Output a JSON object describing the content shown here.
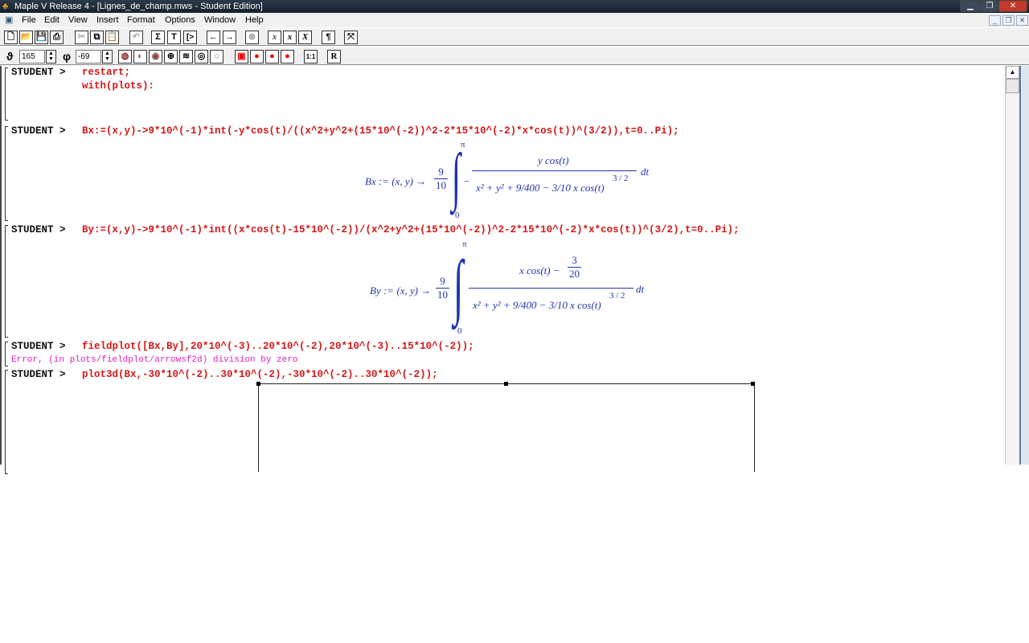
{
  "window": {
    "title": "Maple V Release 4 - [Lignes_de_champ.mws - Student Edition]"
  },
  "menu": [
    "File",
    "Edit",
    "View",
    "Insert",
    "Format",
    "Options",
    "Window",
    "Help"
  ],
  "toolbar1": [
    "new",
    "open",
    "save",
    "print",
    "cut",
    "copy",
    "paste",
    "undo",
    "Σ",
    "T",
    "[>",
    "←",
    "→",
    "stop",
    "x",
    "x",
    "X",
    "¶",
    "⤧"
  ],
  "plot_toolbar": {
    "theta_symbol": "ϑ",
    "theta": "165",
    "phi_symbol": "φ",
    "phi": "-69",
    "ratio": "1:1",
    "r": "R"
  },
  "worksheet": {
    "prompt": "STUDENT >",
    "inputs": [
      [
        "restart;",
        "with(plots):"
      ],
      [
        "Bx:=(x,y)->9*10^(-1)*int(-y*cos(t)/((x^2+y^2+(15*10^(-2))^2-2*15*10^(-2)*x*cos(t))^(3/2)),t=0..Pi);"
      ],
      [
        "By:=(x,y)->9*10^(-1)*int((x*cos(t)-15*10^(-2))/(x^2+y^2+(15*10^(-2))^2-2*15*10^(-2)*x*cos(t))^(3/2),t=0..Pi);"
      ],
      [
        "fieldplot([Bx,By],20*10^(-3)..20*10^(-2),20*10^(-3)..15*10^(-2));"
      ],
      [
        "plot3d(Bx,-30*10^(-2)..30*10^(-2),-30*10^(-2)..30*10^(-2));"
      ]
    ],
    "error": "Error, (in plots/fieldplot/arrowsf2d) division by zero",
    "bx_output": {
      "lhs": "Bx := (x, y) →",
      "coef_n": "9",
      "coef_d": "10",
      "upper": "π",
      "lower": "0",
      "minus": "−",
      "num": "y cos(t)",
      "den": "x² + y² + 9/400 − 3/10 x cos(t)",
      "exp": "3 / 2",
      "dt": "dt"
    },
    "by_output": {
      "lhs": "By := (x, y) →",
      "coef_n": "9",
      "coef_d": "10",
      "upper": "π",
      "lower": "0",
      "num_a": "x cos(t) −",
      "num_n": "3",
      "num_d": "20",
      "exp": "3 / 2",
      "dt": "dt"
    }
  }
}
